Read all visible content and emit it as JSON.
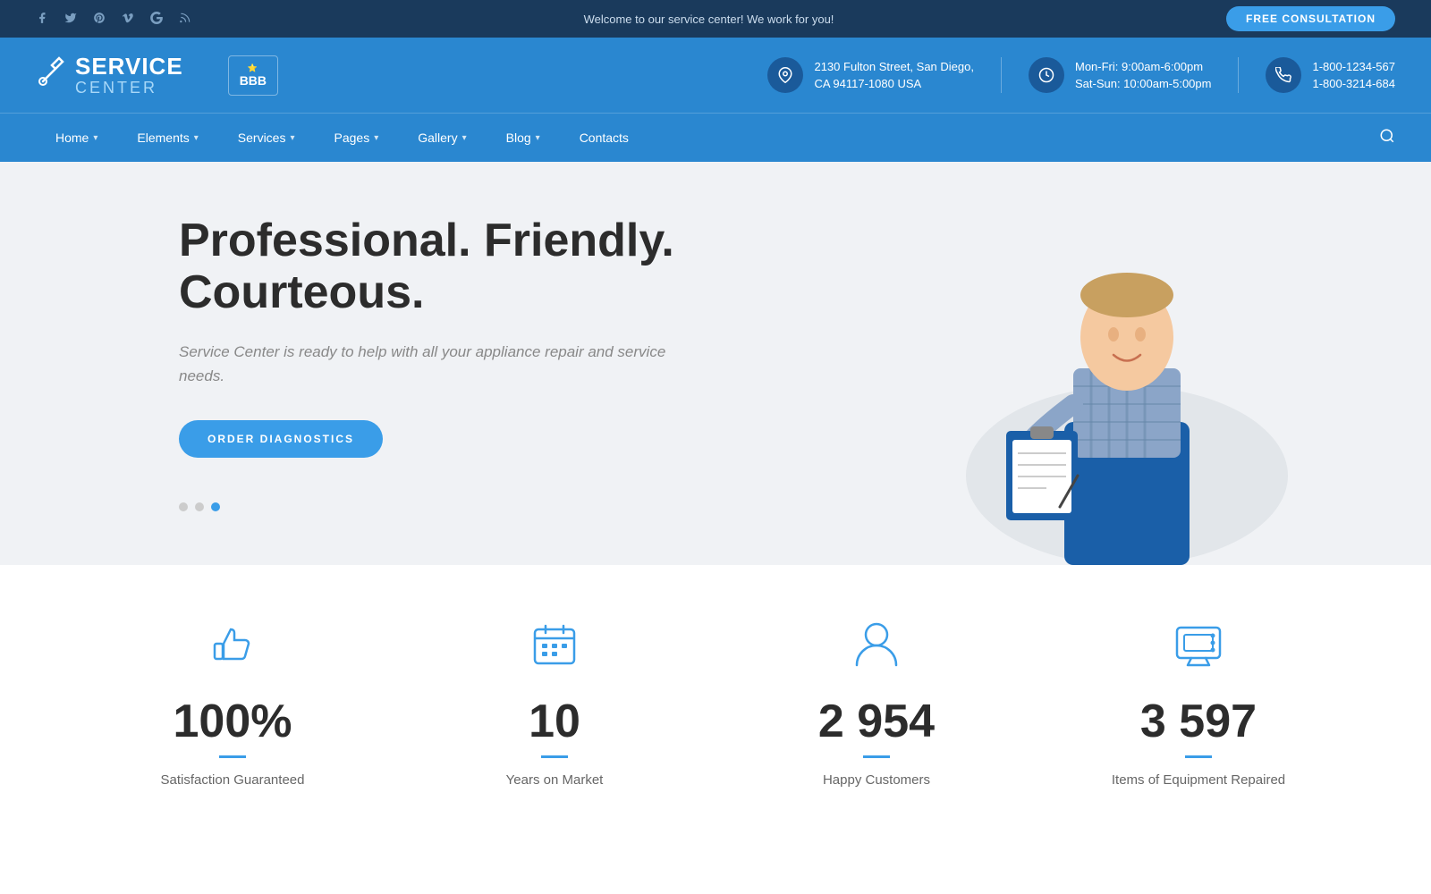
{
  "topbar": {
    "welcome_text": "Welcome to our service center! We work for you!",
    "cta_button": "FREE CONSULTATION",
    "social_links": [
      {
        "name": "facebook",
        "icon": "f"
      },
      {
        "name": "twitter",
        "icon": "t"
      },
      {
        "name": "pinterest",
        "icon": "p"
      },
      {
        "name": "vimeo",
        "icon": "v"
      },
      {
        "name": "google",
        "icon": "g"
      },
      {
        "name": "rss",
        "icon": "r"
      }
    ]
  },
  "header": {
    "logo_service": "SERVICE",
    "logo_center": "CENTER",
    "bbb_label": "BBB",
    "address_icon": "📍",
    "address_line1": "2130 Fulton Street, San Diego,",
    "address_line2": "CA 94117-1080 USA",
    "hours_icon": "🕐",
    "hours_line1": "Mon-Fri: 9:00am-6:00pm",
    "hours_line2": "Sat-Sun: 10:00am-5:00pm",
    "phone_icon": "📞",
    "phone_line1": "1-800-1234-567",
    "phone_line2": "1-800-3214-684"
  },
  "nav": {
    "items": [
      {
        "label": "Home",
        "has_dropdown": true
      },
      {
        "label": "Elements",
        "has_dropdown": true
      },
      {
        "label": "Services",
        "has_dropdown": true
      },
      {
        "label": "Pages",
        "has_dropdown": true
      },
      {
        "label": "Gallery",
        "has_dropdown": true
      },
      {
        "label": "Blog",
        "has_dropdown": true
      },
      {
        "label": "Contacts",
        "has_dropdown": false
      }
    ]
  },
  "hero": {
    "title": "Professional. Friendly. Courteous.",
    "subtitle": "Service Center is ready to help with all your appliance repair and service needs.",
    "cta_button": "ORDER DIAGNOSTICS",
    "dots": [
      {
        "active": false
      },
      {
        "active": false
      },
      {
        "active": true
      }
    ]
  },
  "stats": [
    {
      "icon_name": "thumbs-up-icon",
      "number": "100%",
      "label": "Satisfaction Guaranteed"
    },
    {
      "icon_name": "calendar-icon",
      "number": "10",
      "label": "Years on Market"
    },
    {
      "icon_name": "person-icon",
      "number": "2 954",
      "label": "Happy Customers"
    },
    {
      "icon_name": "tv-icon",
      "number": "3 597",
      "label": "Items of Equipment Repaired"
    }
  ]
}
